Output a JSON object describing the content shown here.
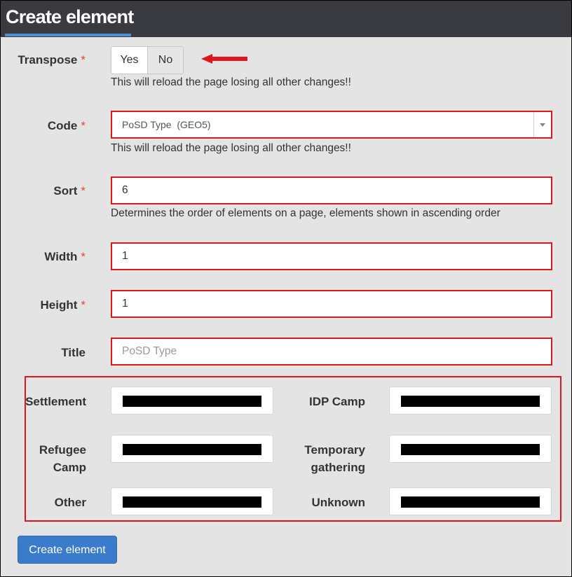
{
  "header": {
    "title": "Create element"
  },
  "required_mark": "*",
  "transpose": {
    "label": "Transpose",
    "options": [
      "Yes",
      "No"
    ],
    "selected": "No",
    "help": "This will reload the page losing all other changes!!"
  },
  "code": {
    "label": "Code",
    "value": "PoSD Type  (GEO5)",
    "help": "This will reload the page losing all other changes!!"
  },
  "sort": {
    "label": "Sort",
    "value": "6",
    "help": "Determines the order of elements on a page, elements shown in ascending order"
  },
  "width": {
    "label": "Width",
    "value": "1"
  },
  "height": {
    "label": "Height",
    "value": "1"
  },
  "title": {
    "label": "Title",
    "placeholder": "PoSD Type"
  },
  "options": [
    {
      "label": "Settlement"
    },
    {
      "label": "IDP Camp"
    },
    {
      "label_lines": [
        "Refugee",
        "Camp"
      ]
    },
    {
      "label_lines": [
        "Temporary",
        "gathering"
      ]
    },
    {
      "label": "Other"
    },
    {
      "label": "Unknown"
    }
  ],
  "submit": {
    "label": "Create element"
  },
  "colors": {
    "header_bg": "#3a3b40",
    "accent": "#4f8fd1",
    "highlight_border": "#e1161c",
    "button_bg": "#3b7bcc",
    "panel_bg": "#e4e4e4"
  },
  "icons": {
    "arrow": "left-arrow-icon",
    "caret": "chevron-down-icon"
  }
}
